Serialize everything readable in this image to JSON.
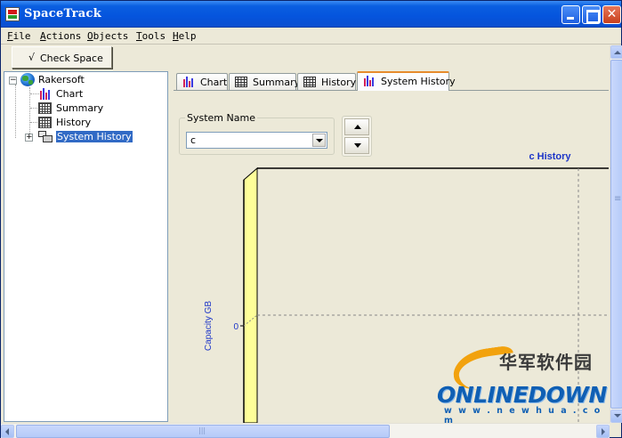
{
  "window": {
    "title": "SpaceTrack",
    "title_bar_color": "#0554dd"
  },
  "menu": {
    "items": [
      "File",
      "Actions",
      "Objects",
      "Tools",
      "Help"
    ]
  },
  "toolbar": {
    "check_space_icon": "√",
    "check_space_label": "Check Space"
  },
  "tree": {
    "root": {
      "label": "Rakersoft",
      "icon": "globe-icon",
      "expander": "−"
    },
    "children": [
      {
        "label": "Chart",
        "icon": "bar-chart-icon"
      },
      {
        "label": "Summary",
        "icon": "grid-icon"
      },
      {
        "label": "History",
        "icon": "grid-icon"
      },
      {
        "label": "System History",
        "icon": "computers-icon",
        "expander": "+",
        "selected": true
      }
    ],
    "selection_color": "#316ac5"
  },
  "tabs": [
    {
      "label": "Chart",
      "icon": "bar-chart-icon",
      "active": false
    },
    {
      "label": "Summary",
      "icon": "grid-icon",
      "active": false
    },
    {
      "label": "History",
      "icon": "grid-icon",
      "active": false
    },
    {
      "label": "System History",
      "icon": "bar-chart-icon",
      "active": true
    }
  ],
  "system_panel": {
    "group_title": "System Name",
    "selected_value": "c"
  },
  "chart_data": {
    "type": "bar",
    "title": "c History",
    "ylabel": "Capacity GB",
    "xlabel": "",
    "y_ticks": [
      "0"
    ],
    "categories": [],
    "series": [],
    "grid": true,
    "title_color": "#1c35c8",
    "ylabel_color": "#1c35c8",
    "axis_wall_color": "#ffff99"
  },
  "watermark": {
    "cn": "华军软件园",
    "brand": "ONLINEDOWN",
    "url": "w w w . n e w h u a . c o m"
  }
}
